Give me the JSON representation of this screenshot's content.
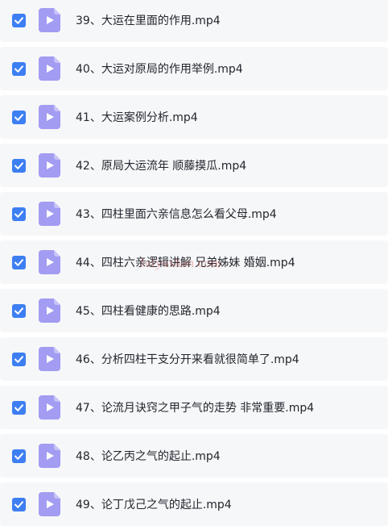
{
  "colors": {
    "checkbox": "#3d7ff3",
    "row_background": "#f6f7f9",
    "video_icon": "#a29cf2",
    "text": "#23262d",
    "watermark": "#dc3c3c"
  },
  "files": [
    {
      "name": "39、大运在里面的作用.mp4",
      "checked": true,
      "icon": "video-file-icon"
    },
    {
      "name": "40、大运对原局的作用举例.mp4",
      "checked": true,
      "icon": "video-file-icon"
    },
    {
      "name": "41、大运案例分析.mp4",
      "checked": true,
      "icon": "video-file-icon"
    },
    {
      "name": "42、原局大运流年 顺藤摸瓜.mp4",
      "checked": true,
      "icon": "video-file-icon"
    },
    {
      "name": "43、四柱里面六亲信息怎么看父母.mp4",
      "checked": true,
      "icon": "video-file-icon"
    },
    {
      "name": "44、四柱六亲逻辑讲解 兄弟姊妹 婚姻.mp4",
      "checked": true,
      "icon": "video-file-icon"
    },
    {
      "name": "45、四柱看健康的思路.mp4",
      "checked": true,
      "icon": "video-file-icon"
    },
    {
      "name": "46、分析四柱干支分开来看就很简单了.mp4",
      "checked": true,
      "icon": "video-file-icon"
    },
    {
      "name": "47、论流月诀窍之甲子气的走势 非常重要.mp4",
      "checked": true,
      "icon": "video-file-icon"
    },
    {
      "name": "48、论乙丙之气的起止.mp4",
      "checked": true,
      "icon": "video-file-icon"
    },
    {
      "name": "49、论丁戊己之气的起止.mp4",
      "checked": true,
      "icon": "video-file-icon"
    }
  ],
  "watermark": "fuiyushan.com"
}
